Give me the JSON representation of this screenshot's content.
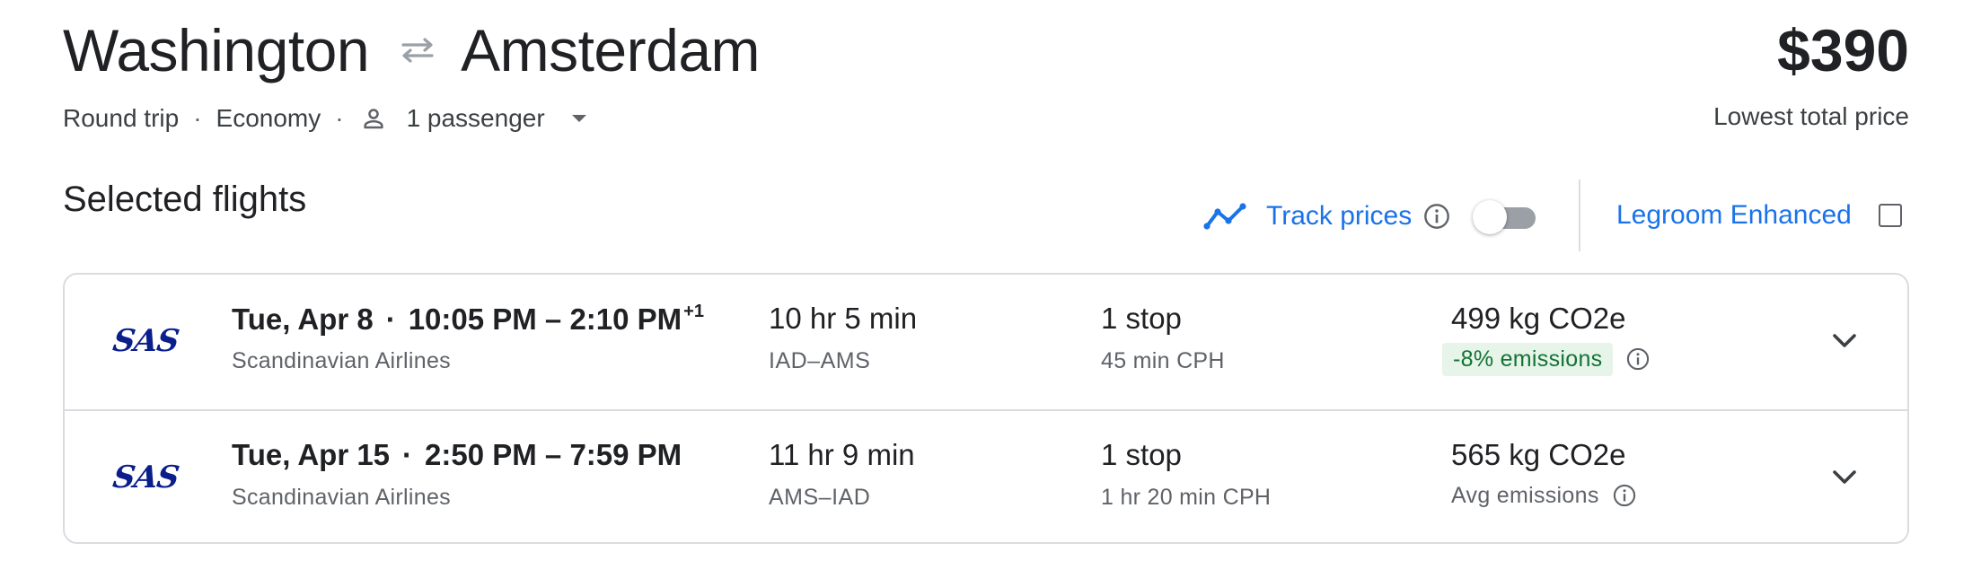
{
  "header": {
    "origin": "Washington",
    "destination": "Amsterdam",
    "swap_icon": "swap-arrows-icon",
    "price": "$390",
    "price_caption": "Lowest total price"
  },
  "trip_options": {
    "trip_type": "Round trip",
    "separator": "·",
    "cabin_class": "Economy",
    "passengers": "1 passenger",
    "person_icon": "person-icon",
    "dropdown_icon": "caret-down-icon"
  },
  "section": {
    "title": "Selected flights"
  },
  "track_prices": {
    "label": "Track prices",
    "enabled": false,
    "icon": "trend-line-icon",
    "info_icon": "info-icon"
  },
  "legroom": {
    "label": "Legroom Enhanced",
    "checked": false
  },
  "flights": [
    {
      "airline_logo": "SAS",
      "date": "Tue, Apr 8",
      "separator": "·",
      "times": "10:05 PM – 2:10 PM",
      "day_offset": "+1",
      "airline": "Scandinavian Airlines",
      "duration": "10 hr 5 min",
      "route": "IAD–AMS",
      "stops": "1 stop",
      "layover": "45 min CPH",
      "co2": "499 kg CO2e",
      "emissions": "-8% emissions",
      "emissions_highlight": true
    },
    {
      "airline_logo": "SAS",
      "date": "Tue, Apr 15",
      "separator": "·",
      "times": "2:50 PM – 7:59 PM",
      "day_offset": "",
      "airline": "Scandinavian Airlines",
      "duration": "11 hr 9 min",
      "route": "AMS–IAD",
      "stops": "1 stop",
      "layover": "1 hr 20 min CPH",
      "co2": "565 kg CO2e",
      "emissions": "Avg emissions",
      "emissions_highlight": false
    }
  ],
  "colors": {
    "accent": "#1a73e8",
    "text": "#202124",
    "secondary_text": "#5f6368",
    "badge_bg": "#e6f4ea",
    "badge_text": "#137333",
    "airline_brand": "#0a1e8c",
    "divider": "#dadce0"
  }
}
